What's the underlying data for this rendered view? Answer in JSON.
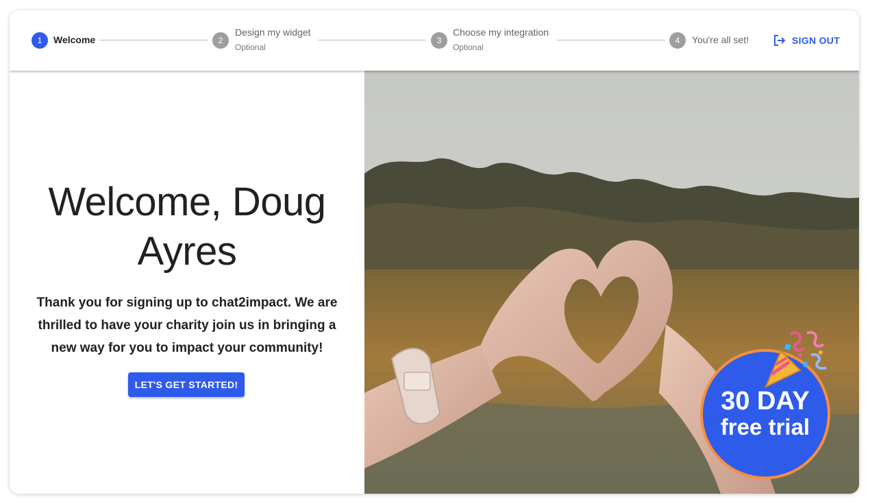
{
  "stepper": {
    "steps": [
      {
        "number": "1",
        "label": "Welcome",
        "sublabel": ""
      },
      {
        "number": "2",
        "label": "Design my widget",
        "sublabel": "Optional"
      },
      {
        "number": "3",
        "label": "Choose my integration",
        "sublabel": "Optional"
      },
      {
        "number": "4",
        "label": "You're all set!",
        "sublabel": ""
      }
    ],
    "active_step": 1
  },
  "header": {
    "signout_label": "SIGN OUT",
    "signout_icon": "logout-icon"
  },
  "welcome": {
    "headline": "Welcome, Doug Ayres",
    "body_prefix": "Thank you for signing up to ",
    "brand": "chat2impact.",
    "body_suffix": " We are thrilled to have your charity join us in bringing a new way for you to impact your community!",
    "cta_label": "LET'S GET STARTED!"
  },
  "hero": {
    "image_subject": "hands-forming-heart-in-field",
    "badge_line1": "30 DAY",
    "badge_line2": "free trial",
    "badge_icon": "party-popper-icon"
  },
  "colors": {
    "accent": "#2f5bea",
    "badge_border": "#f3903f",
    "inactive_step": "#9e9e9e"
  }
}
